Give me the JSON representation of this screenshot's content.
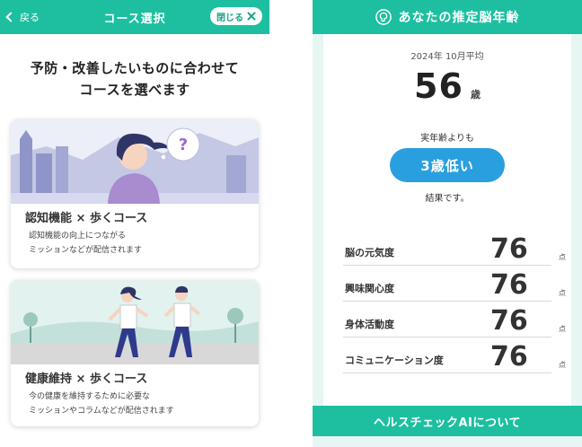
{
  "course_screen": {
    "header": {
      "back_label": "戻る",
      "title": "コース選択",
      "close_label": "閉じる"
    },
    "heading_lines": [
      "予防・改善したいものに合わせて",
      "コースを選べます"
    ],
    "courses": [
      {
        "title": "認知機能 × 歩くコース",
        "description_lines": [
          "認知機能の向上につながる",
          "ミッションなどが配信されます"
        ],
        "illustration_glyph": "?"
      },
      {
        "title": "健康維持 × 歩くコース",
        "description_lines": [
          "今の健康を維持するために必要な",
          "ミッションやコラムなどが配信されます"
        ]
      }
    ]
  },
  "brain_age_screen": {
    "header_title": "あなたの推定脳年齢",
    "header_icon": "brain-head-icon",
    "period": "2024年 10月平均",
    "age_value": "56",
    "age_unit": "歳",
    "compare_text": "実年齢よりも",
    "badge_text": "3歳低い",
    "result_text": "結果です。",
    "scores": [
      {
        "label": "脳の元気度",
        "value": "76",
        "unit": "点"
      },
      {
        "label": "興味関心度",
        "value": "76",
        "unit": "点"
      },
      {
        "label": "身体活動度",
        "value": "76",
        "unit": "点"
      },
      {
        "label": "コミュニケーション度",
        "value": "76",
        "unit": "点"
      }
    ],
    "footer_label": "ヘルスチェックAIについて"
  },
  "colors": {
    "brand_teal": "#1dbfa0",
    "badge_blue": "#2a9fe0",
    "panel_bg": "#e6f6f3"
  }
}
